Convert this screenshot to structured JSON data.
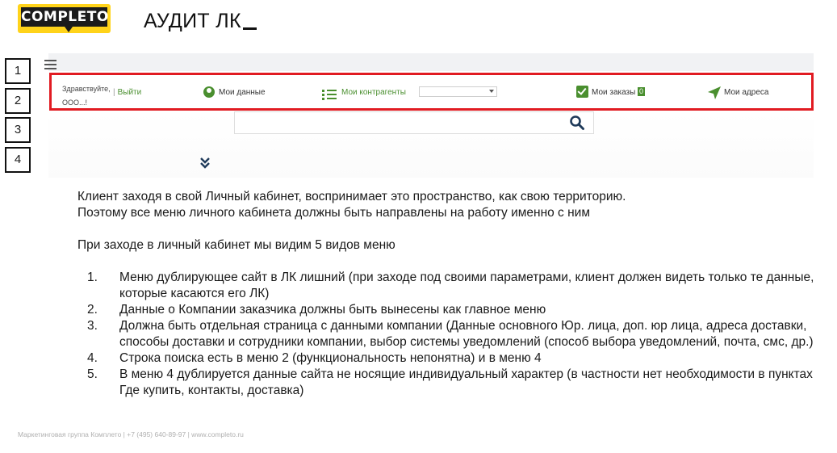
{
  "logo": {
    "text": "COMPLETO"
  },
  "slide": {
    "title": "АУДИТ ЛК"
  },
  "markers": [
    "1",
    "2",
    "3",
    "4"
  ],
  "menu": {
    "greeting_line1": "Здравствуйте,",
    "greeting_line2": "ООО...!",
    "logout": "Выйти",
    "my_data": "Мои данные",
    "my_contractors": "Мои контрагенты",
    "contractor_select_value": "",
    "my_orders": "Мои заказы",
    "orders_count": "0",
    "my_addresses": "Мои адреса"
  },
  "colors": {
    "accent_green": "#4a8f2f",
    "highlight_red": "#e11b22",
    "logo_yellow": "#ffd31a"
  },
  "icons": [
    "hamburger-icon",
    "user-icon",
    "list-icon",
    "checkbox-icon",
    "navigation-icon",
    "search-icon",
    "double-chevron-down-icon"
  ],
  "body": {
    "intro_line1": "Клиент заходя в свой Личный кабинет, воспринимает это пространство, как свою территорию.",
    "intro_line2": "Поэтому все меню личного кабинета должны быть направлены на работу именно с ним",
    "menus_intro": "При заходе в личный кабинет мы видим 5 видов меню",
    "items": [
      {
        "num": "1.",
        "text": "Меню дублирующее сайт в ЛК лишний (при заходе под своими параметрами, клиент должен видеть только те данные, которые касаются его ЛК)"
      },
      {
        "num": "2.",
        "text": "Данные о Компании заказчика должны быть вынесены как главное меню"
      },
      {
        "num": "3.",
        "text": "Должна быть отдельная страница с данными компании (Данные основного Юр. лица,  доп. юр лица, адреса доставки, способы доставки и сотрудники компании, выбор системы уведомлений (способ выбора уведомлений, почта, смс, др.)"
      },
      {
        "num": "4.",
        "text": "Строка поиска есть в меню  2 (функциональность непонятна) и в меню 4"
      },
      {
        "num": "5.",
        "text": "В меню 4 дублируется данные сайта не носящие индивидуальный характер (в частности  нет необходимости в пунктах Где купить, контакты, доставка)"
      }
    ]
  },
  "footer": {
    "text": "Маркетинговая группа Комплето  |  +7 (495) 640-89-97  |  www.completo.ru"
  }
}
